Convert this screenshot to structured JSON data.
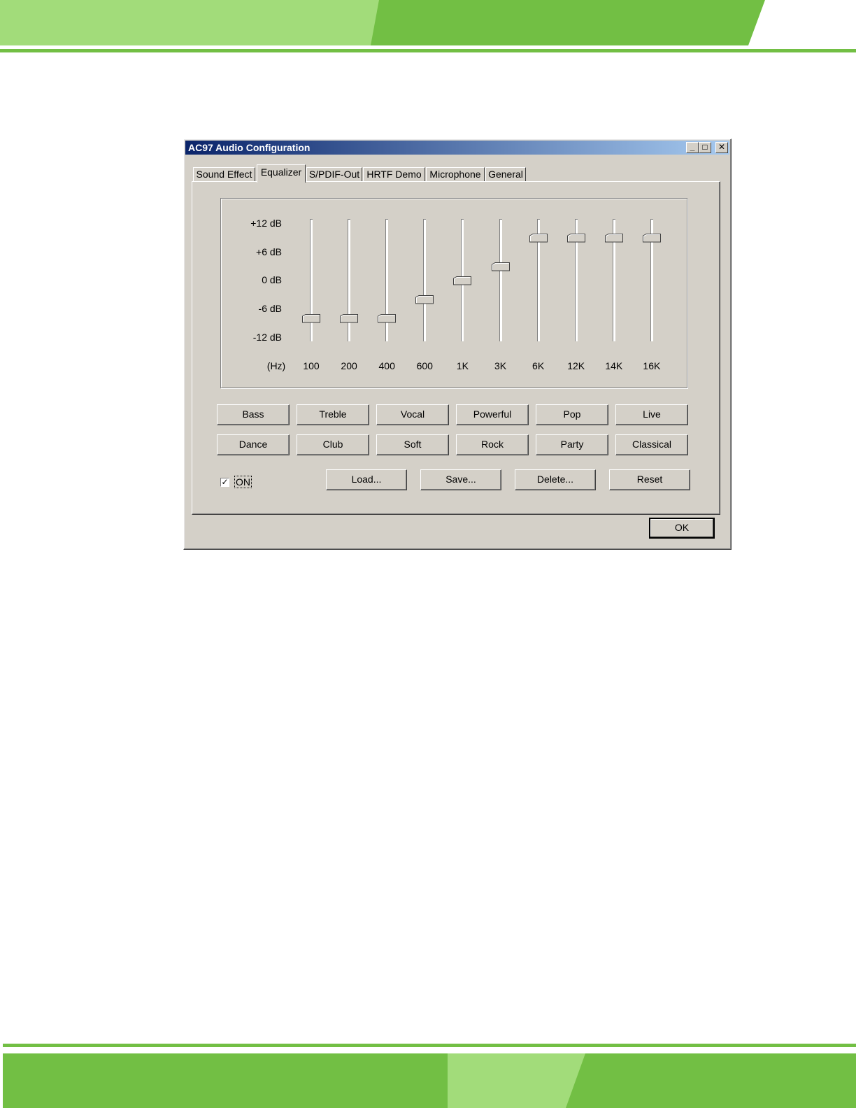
{
  "page": {
    "accent_color": "#72bf44",
    "accent_light_color": "#a2dc7a"
  },
  "window": {
    "title": "AC97 Audio Configuration",
    "controls": {
      "minimize_icon": "minimize-icon",
      "maximize_icon": "maximize-icon",
      "close_icon": "close-icon"
    },
    "titlebar_color": "#0a246a"
  },
  "tabs": [
    {
      "label": "Sound Effect"
    },
    {
      "label": "Equalizer",
      "active": true
    },
    {
      "label": "S/PDIF-Out"
    },
    {
      "label": "HRTF Demo"
    },
    {
      "label": "Microphone"
    },
    {
      "label": "General"
    }
  ],
  "equalizer": {
    "db_scale": [
      "+12 dB",
      "+6 dB",
      "0 dB",
      "-6 dB",
      "-12 dB"
    ],
    "hz_unit": "(Hz)",
    "bands": [
      {
        "freq": "100",
        "gain_db": -8
      },
      {
        "freq": "200",
        "gain_db": -8
      },
      {
        "freq": "400",
        "gain_db": -8
      },
      {
        "freq": "600",
        "gain_db": -4
      },
      {
        "freq": "1K",
        "gain_db": 0
      },
      {
        "freq": "3K",
        "gain_db": 3
      },
      {
        "freq": "6K",
        "gain_db": 9
      },
      {
        "freq": "12K",
        "gain_db": 9
      },
      {
        "freq": "14K",
        "gain_db": 9
      },
      {
        "freq": "16K",
        "gain_db": 9
      }
    ],
    "gain_range_db": [
      -12,
      12
    ]
  },
  "presets": {
    "row1": [
      "Bass",
      "Treble",
      "Vocal",
      "Powerful",
      "Pop",
      "Live"
    ],
    "row2": [
      "Dance",
      "Club",
      "Soft",
      "Rock",
      "Party",
      "Classical"
    ]
  },
  "on_toggle": {
    "label": "ON",
    "checked": true,
    "check_mark": "✓"
  },
  "actions": {
    "load": "Load...",
    "save": "Save...",
    "delete": "Delete...",
    "reset": "Reset"
  },
  "ok_label": "OK"
}
